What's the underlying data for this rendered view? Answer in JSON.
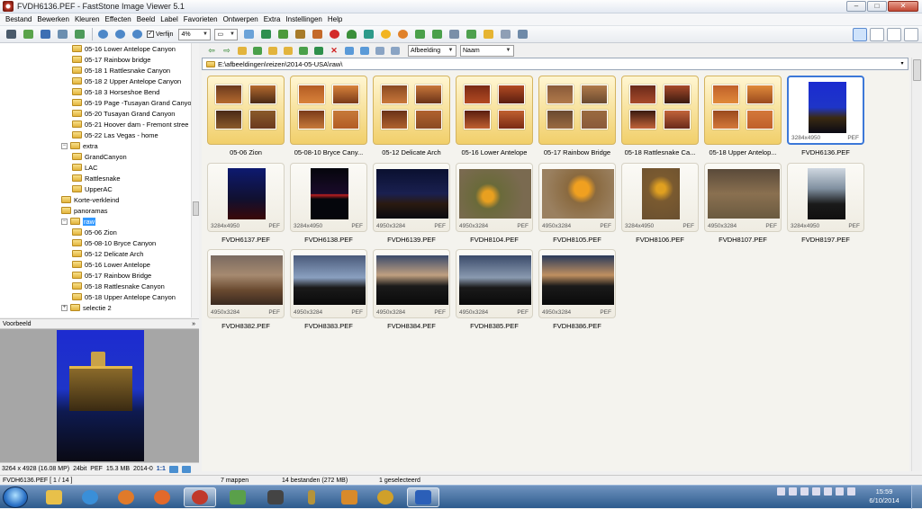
{
  "window": {
    "title": "FVDH6136.PEF  -  FastStone Image Viewer 5.1",
    "minimize": "–",
    "maximize": "□",
    "close": "✕"
  },
  "menu": [
    "Bestand",
    "Bewerken",
    "Kleuren",
    "Effecten",
    "Beeld",
    "Label",
    "Favorieten",
    "Ontwerpen",
    "Extra",
    "Instellingen",
    "Help"
  ],
  "toolbar": {
    "refine_label": "Verfijn",
    "refine_checked": "✓",
    "zoom_value": "4%",
    "sort_view": "Afbeelding",
    "sort_by": "Naam"
  },
  "tree": [
    {
      "label": "05-16 Lower Antelope Canyon",
      "level": 3
    },
    {
      "label": "05-17 Rainbow bridge",
      "level": 3
    },
    {
      "label": "05-18 1 Rattlesnake Canyon",
      "level": 3
    },
    {
      "label": "05-18 2 Upper Antelope Canyon",
      "level": 3
    },
    {
      "label": "05-18 3 Horseshoe Bend",
      "level": 3
    },
    {
      "label": "05-19 Page -Tusayan Grand Canyo",
      "level": 3
    },
    {
      "label": "05-20 Tusayan Grand Canyon",
      "level": 3
    },
    {
      "label": "05-21 Hoover dam - Fremont stree",
      "level": 3
    },
    {
      "label": "05-22 Las Vegas - home",
      "level": 3
    },
    {
      "label": "extra",
      "level": 2,
      "expander": "−"
    },
    {
      "label": "GrandCanyon",
      "level": 3
    },
    {
      "label": "LAC",
      "level": 3
    },
    {
      "label": "Rattlesnake",
      "level": 3
    },
    {
      "label": "UpperAC",
      "level": 3
    },
    {
      "label": "Korte-verkleind",
      "level": 2
    },
    {
      "label": "panoramas",
      "level": 2
    },
    {
      "label": "raw",
      "level": 2,
      "expander": "−",
      "selected": true
    },
    {
      "label": "05-06 Zion",
      "level": 3
    },
    {
      "label": "05-08-10 Bryce Canyon",
      "level": 3
    },
    {
      "label": "05-12 Delicate Arch",
      "level": 3
    },
    {
      "label": "05-16 Lower Antelope",
      "level": 3
    },
    {
      "label": "05-17 Rainbow Bridge",
      "level": 3
    },
    {
      "label": "05-18 Rattlesnake Canyon",
      "level": 3
    },
    {
      "label": "05-18 Upper Antelope Canyon",
      "level": 3
    },
    {
      "label": "selectie 2",
      "level": 2,
      "expander": "+"
    }
  ],
  "preview": {
    "header": "Voorbeeld",
    "collapse": "»"
  },
  "image_info": {
    "dimensions": "3264 x 4928 (16.08 MP)",
    "bitdepth": "24bit",
    "format": "PEF",
    "size": "15.3 MB",
    "date": "2014-0",
    "ratio": "1:1"
  },
  "address": {
    "path": "E:\\afbeeldingen\\reizen\\2014-05-USA\\raw\\",
    "drop": "▾"
  },
  "folders": [
    "05-06 Zion",
    "05-08-10 Bryce Cany...",
    "05-12 Delicate Arch",
    "05-16 Lower Antelope",
    "05-17 Rainbow Bridge",
    "05-18 Rattlesnake Ca...",
    "05-18 Upper Antelop..."
  ],
  "files": [
    {
      "name": "FVDH6136.PEF",
      "dims": "3284x4950",
      "ext": "PEF",
      "selected": true
    },
    {
      "name": "FVDH6137.PEF",
      "dims": "3284x4950",
      "ext": "PEF"
    },
    {
      "name": "FVDH6138.PEF",
      "dims": "3284x4950",
      "ext": "PEF"
    },
    {
      "name": "FVDH6139.PEF",
      "dims": "4950x3284",
      "ext": "PEF"
    },
    {
      "name": "FVDH8104.PEF",
      "dims": "4950x3284",
      "ext": "PEF"
    },
    {
      "name": "FVDH8105.PEF",
      "dims": "4950x3284",
      "ext": "PEF"
    },
    {
      "name": "FVDH8106.PEF",
      "dims": "3284x4950",
      "ext": "PEF"
    },
    {
      "name": "FVDH8107.PEF",
      "dims": "4950x3284",
      "ext": "PEF"
    },
    {
      "name": "FVDH8197.PEF",
      "dims": "3284x4950",
      "ext": "PEF"
    },
    {
      "name": "FVDH8382.PEF",
      "dims": "4950x3284",
      "ext": "PEF"
    },
    {
      "name": "FVDH8383.PEF",
      "dims": "4950x3284",
      "ext": "PEF"
    },
    {
      "name": "FVDH8384.PEF",
      "dims": "4950x3284",
      "ext": "PEF"
    },
    {
      "name": "FVDH8385.PEF",
      "dims": "4950x3284",
      "ext": "PEF"
    },
    {
      "name": "FVDH8386.PEF",
      "dims": "4950x3284",
      "ext": "PEF"
    }
  ],
  "status": {
    "file": "FVDH6136.PEF [ 1 / 14 ]",
    "folders": "7 mappen",
    "files": "14 bestanden (272 MB)",
    "selected": "1 geselecteerd"
  },
  "clock": {
    "time": "15:59",
    "date": "6/10/2014"
  },
  "colors": {
    "accent": "#3399ff",
    "selection_border": "#3c78d8",
    "folder_yellow": "#f1cf6a"
  }
}
